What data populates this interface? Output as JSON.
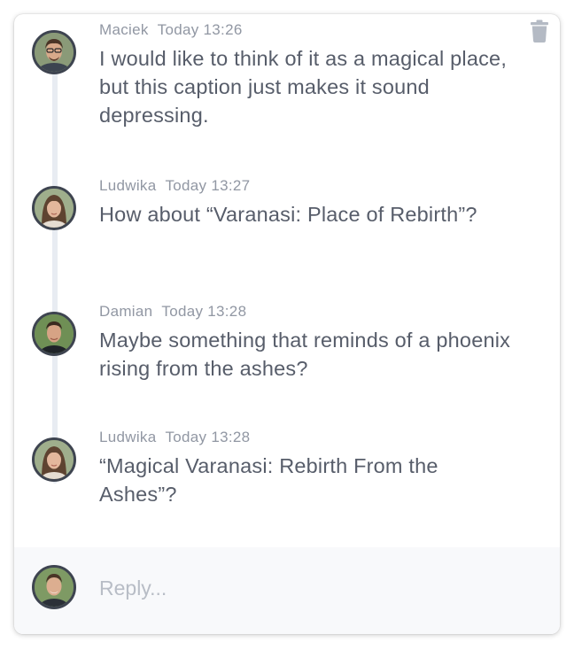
{
  "comments": [
    {
      "author": "Maciek",
      "time": "Today 13:26",
      "text": "I would like to think of it as a magical place, but this caption just makes it sound depressing."
    },
    {
      "author": "Ludwika",
      "time": "Today 13:27",
      "text": "How about “Varanasi: Place of Rebirth”?"
    },
    {
      "author": "Damian",
      "time": "Today 13:28",
      "text": "Maybe something that reminds of a phoenix rising from the ashes?"
    },
    {
      "author": "Ludwika",
      "time": "Today 13:28",
      "text": "“Magical Varanasi: Rebirth From the Ashes”?"
    }
  ],
  "reply": {
    "placeholder": "Reply...",
    "value": ""
  },
  "icons": {
    "delete": "trash-icon"
  },
  "colors": {
    "text": "#575d6a",
    "meta": "#9197a3",
    "placeholder": "#b8bdc6",
    "avatar_border": "#3e4450",
    "thread_line": "#e8ecf2",
    "trash": "#b4bac4"
  }
}
